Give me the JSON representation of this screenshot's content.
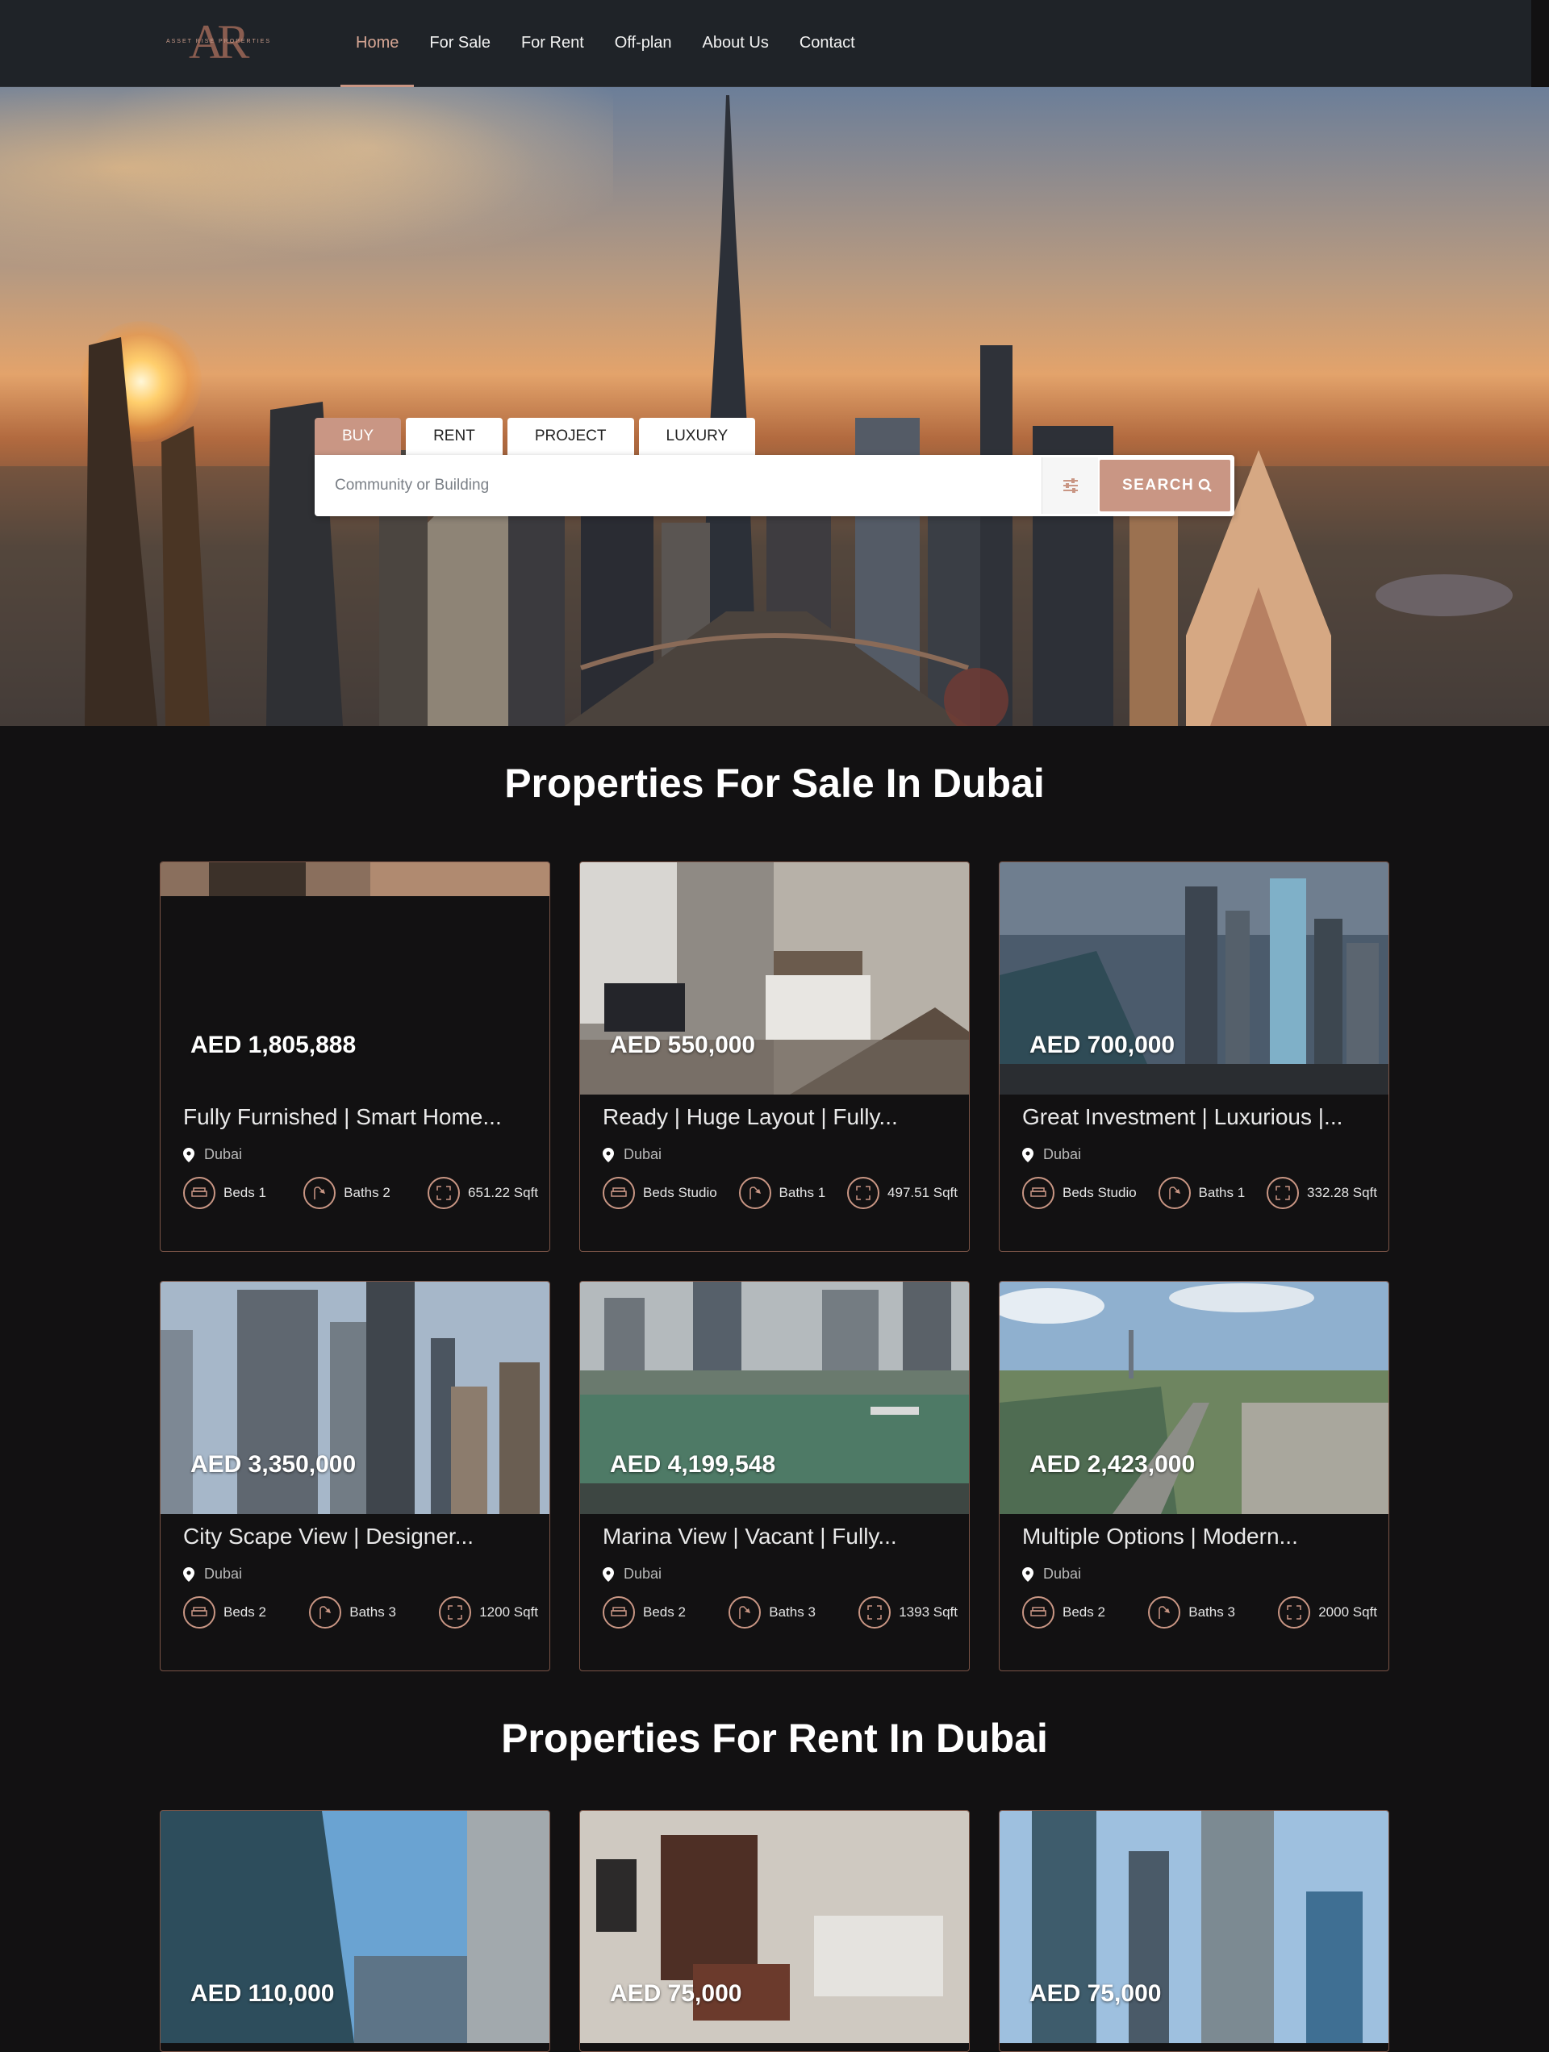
{
  "nav": {
    "logo_text": "AR",
    "logo_sub": "ASSET RISE PROPERTIES",
    "items": [
      "Home",
      "For Sale",
      "For Rent",
      "Off-plan",
      "About Us",
      "Contact"
    ]
  },
  "search": {
    "tabs": [
      "BUY",
      "RENT",
      "PROJECT",
      "LUXURY"
    ],
    "placeholder": "Community or Building",
    "button": "SEARCH"
  },
  "sale": {
    "title": "Properties For Sale In Dubai",
    "cards": [
      {
        "price": "AED 1,805,888",
        "title": "Fully Furnished | Smart Home...",
        "location": "Dubai",
        "beds": "Beds 1",
        "baths": "Baths 2",
        "area": "651.22 Sqft"
      },
      {
        "price": "AED 550,000",
        "title": "Ready | Huge Layout | Fully...",
        "location": "Dubai",
        "beds": "Beds Studio",
        "baths": "Baths 1",
        "area": "497.51 Sqft"
      },
      {
        "price": "AED 700,000",
        "title": "Great Investment | Luxurious |...",
        "location": "Dubai",
        "beds": "Beds Studio",
        "baths": "Baths 1",
        "area": "332.28 Sqft"
      },
      {
        "price": "AED 3,350,000",
        "title": "City Scape View | Designer...",
        "location": "Dubai",
        "beds": "Beds 2",
        "baths": "Baths 3",
        "area": "1200 Sqft"
      },
      {
        "price": "AED 4,199,548",
        "title": "Marina View | Vacant | Fully...",
        "location": "Dubai",
        "beds": "Beds 2",
        "baths": "Baths 3",
        "area": "1393 Sqft"
      },
      {
        "price": "AED 2,423,000",
        "title": "Multiple Options | Modern...",
        "location": "Dubai",
        "beds": "Beds 2",
        "baths": "Baths 3",
        "area": "2000 Sqft"
      }
    ]
  },
  "rent": {
    "title": "Properties For Rent In Dubai",
    "cards": [
      {
        "price": "AED 110,000"
      },
      {
        "price": "AED 75,000"
      },
      {
        "price": "AED 75,000"
      }
    ]
  },
  "colors": {
    "accent": "#c99684",
    "background": "#121112",
    "nav": "#1f2328"
  }
}
